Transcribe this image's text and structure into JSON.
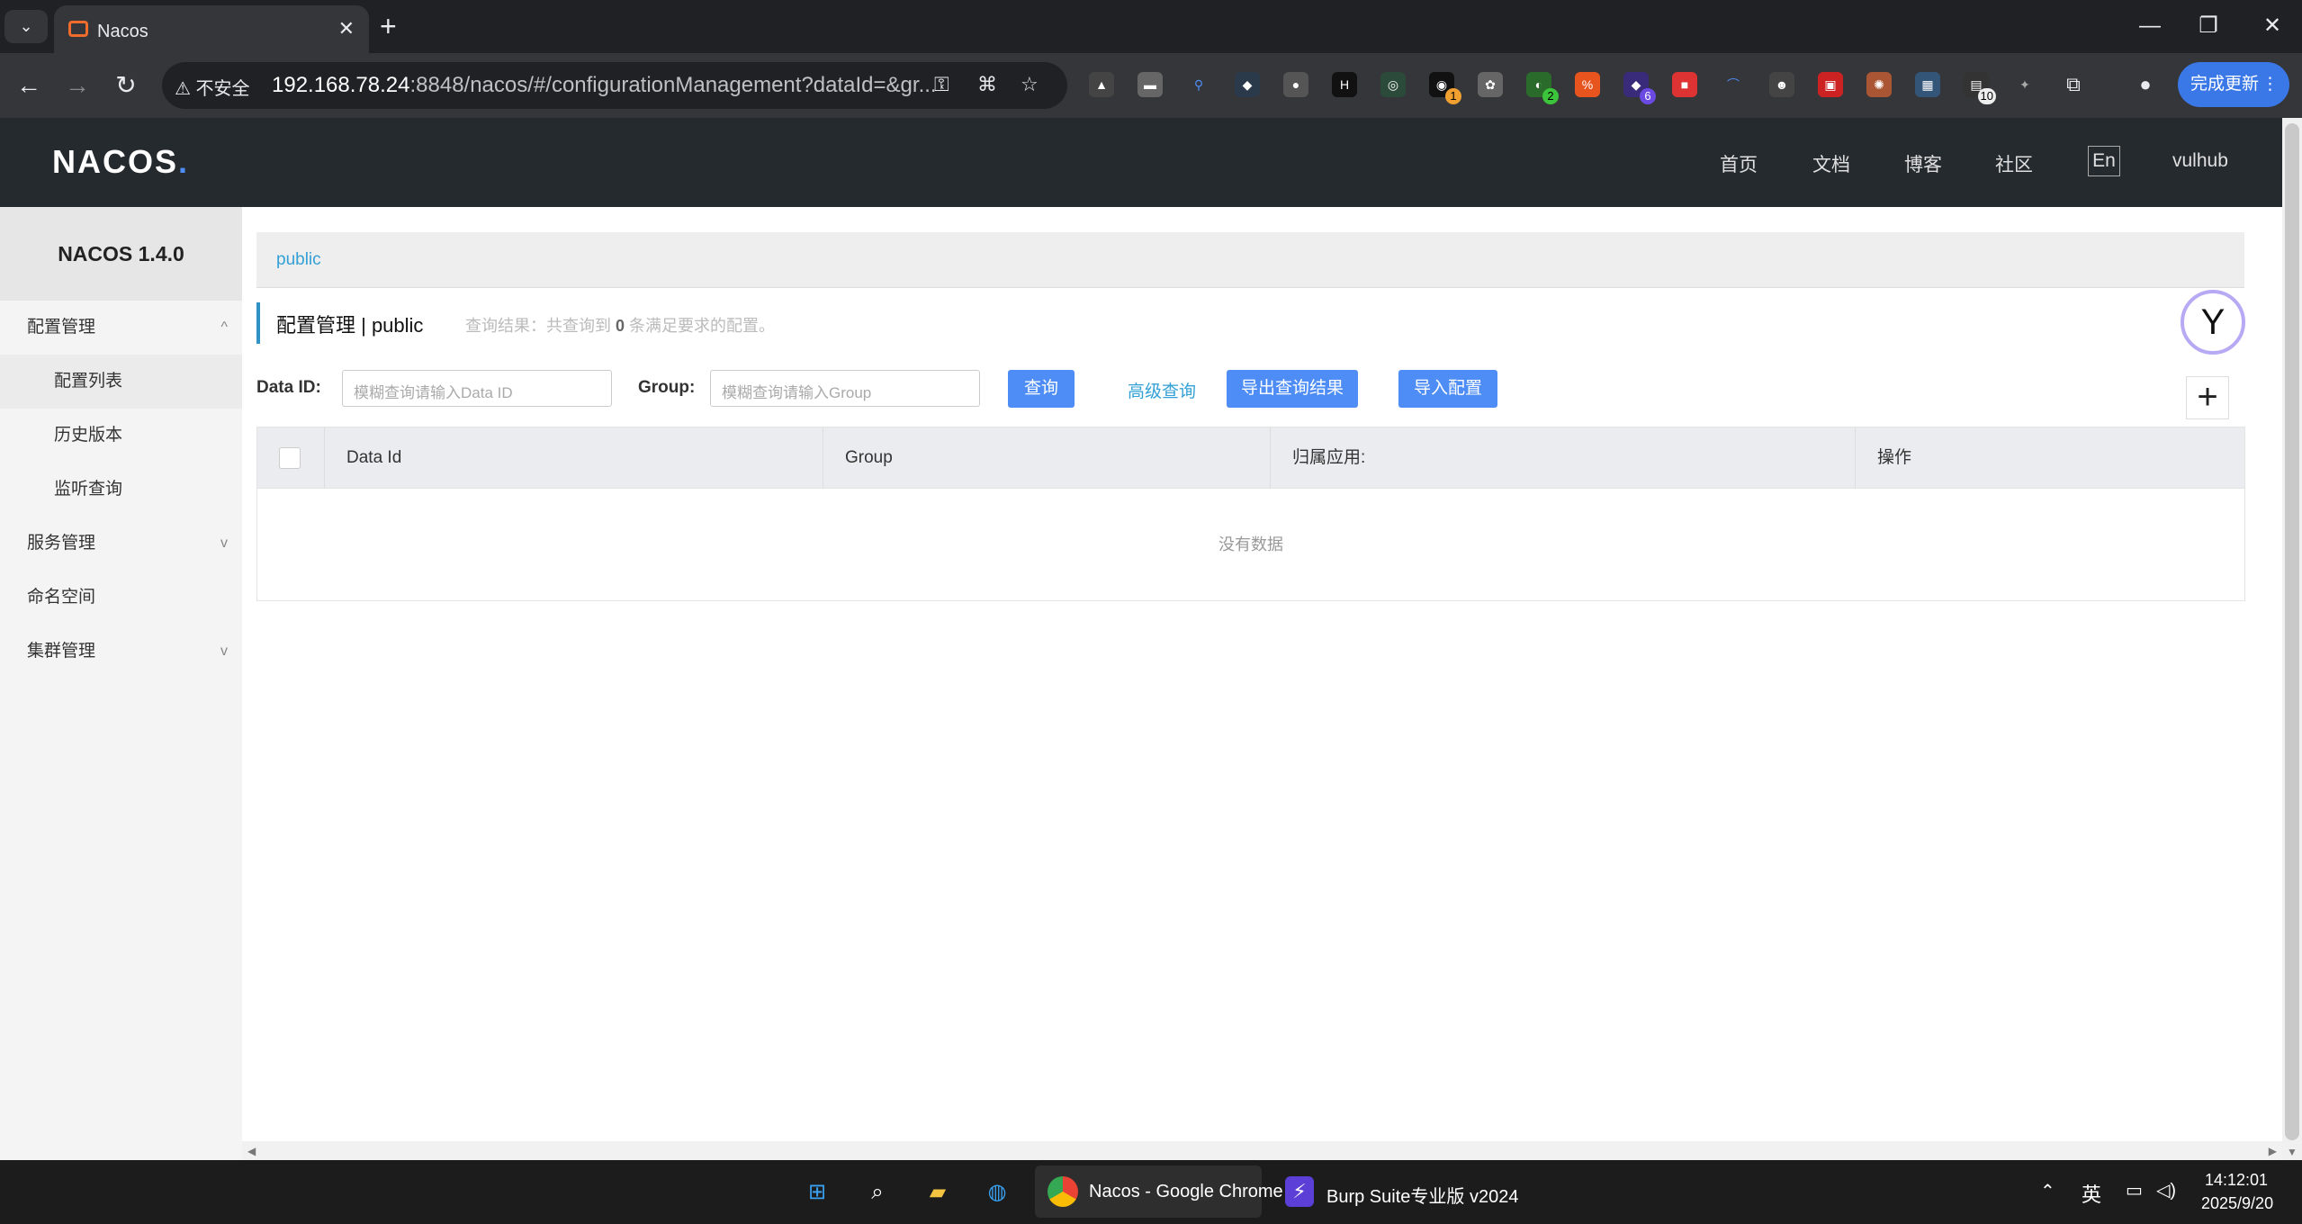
{
  "browser": {
    "tab_title": "Nacos",
    "tab_close": "✕",
    "new_tab": "+",
    "insecure_label": "不安全",
    "url_host": "192.168.78.24",
    "url_rest": ":8848/nacos/#/configurationManagement?dataId=&gr...",
    "update_button": "完成更新",
    "extension_badges": [
      "1",
      "2",
      "6",
      "10"
    ],
    "minimize": "—",
    "restore": "❐",
    "close": "✕"
  },
  "header": {
    "logo_main": "NACOS",
    "logo_dot": ".",
    "nav": [
      "首页",
      "文档",
      "博客",
      "社区"
    ],
    "lang": "En",
    "user": "vulhub"
  },
  "sidebar": {
    "title": "NACOS 1.4.0",
    "items": [
      {
        "label": "配置管理",
        "chevron": "^"
      },
      {
        "label": "配置列表"
      },
      {
        "label": "历史版本"
      },
      {
        "label": "监听查询"
      },
      {
        "label": "服务管理",
        "chevron": "v"
      },
      {
        "label": "命名空间"
      },
      {
        "label": "集群管理",
        "chevron": "v"
      }
    ]
  },
  "main": {
    "namespace": "public",
    "page_title": "配置管理  |  public",
    "result_prefix": "查询结果：共查询到",
    "result_count": "0",
    "result_suffix": "条满足要求的配置。",
    "filters": {
      "data_id_label": "Data ID:",
      "data_id_placeholder": "模糊查询请输入Data ID",
      "group_label": "Group:",
      "group_placeholder": "模糊查询请输入Group"
    },
    "buttons": {
      "query": "查询",
      "advanced": "高级查询",
      "export": "导出查询结果",
      "import": "导入配置",
      "add": "+"
    },
    "table": {
      "columns": [
        "Data Id",
        "Group",
        "归属应用:",
        "操作"
      ],
      "empty_text": "没有数据"
    }
  },
  "taskbar": {
    "chrome_label": "Nacos - Google Chrome",
    "burp_label": "Burp Suite专业版  v2024",
    "ime": "英",
    "time": "14:12:01",
    "date": "2025/9/20"
  }
}
